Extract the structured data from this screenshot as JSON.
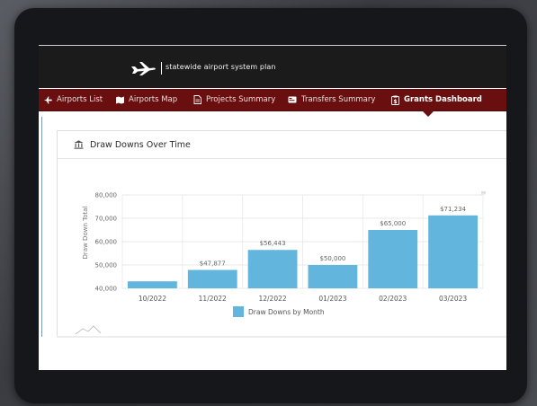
{
  "header": {
    "logo_text": "statewide airport system plan"
  },
  "nav": {
    "items": [
      {
        "label": "Airports List",
        "icon": "plane-icon"
      },
      {
        "label": "Airports Map",
        "icon": "map-icon"
      },
      {
        "label": "Projects Summary",
        "icon": "document-icon"
      },
      {
        "label": "Transfers Summary",
        "icon": "card-icon"
      },
      {
        "label": "Grants Dashboard",
        "icon": "clipboard-dollar-icon",
        "active": true
      }
    ]
  },
  "card": {
    "title": "Draw Downs Over Time",
    "icon": "bank-icon"
  },
  "colors": {
    "nav_bg": "#6a0f0f",
    "bar": "#62b5dd"
  },
  "chart_data": {
    "type": "bar",
    "ylabel": "Draw Down Total",
    "ylim": [
      40000,
      80000
    ],
    "yticks": [
      "40,000",
      "50,000",
      "60,000",
      "70,000",
      "80,000"
    ],
    "categories": [
      "10/2022",
      "11/2022",
      "12/2022",
      "01/2023",
      "02/2023",
      "03/2023"
    ],
    "series": [
      {
        "name": "Draw Downs by Month",
        "values": [
          43000,
          47877,
          56443,
          50000,
          65000,
          71234
        ],
        "labels": [
          "",
          "$47,877",
          "$56,443",
          "$50,000",
          "$65,000",
          "$71,234"
        ]
      }
    ],
    "grid": true,
    "legend": "bottom"
  }
}
